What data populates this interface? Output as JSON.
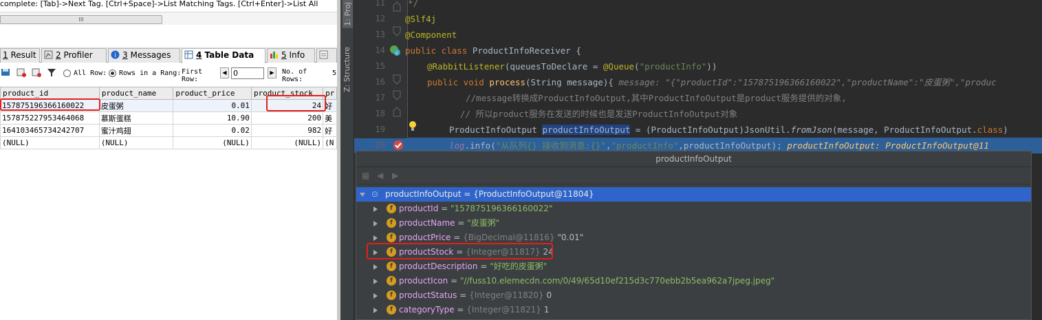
{
  "left": {
    "hint": "complete: [Tab]->Next Tag. [Ctrl+Space]->List Matching Tags. [Ctrl+Enter]->List All",
    "scroll_grip": "III",
    "tabs": [
      {
        "num": "1",
        "label": "Result"
      },
      {
        "num": "2",
        "label": "Profiler"
      },
      {
        "num": "3",
        "label": "Messages"
      },
      {
        "num": "4",
        "label": "Table Data"
      },
      {
        "num": "5",
        "label": "Info"
      }
    ],
    "toolbar": {
      "all_rows": "All Row:",
      "rows_in_range": "Rows in a Rang:",
      "first_row": "First\nRow:",
      "first_row_value": "0",
      "no_of_rows": "No. of\nRows:",
      "rows_value": "5"
    },
    "table": {
      "columns": [
        "product_id",
        "product_name",
        "product_price",
        "product_stock",
        "pr"
      ],
      "rows": [
        [
          "157875196366160022",
          "皮蛋粥",
          "0.01",
          "24",
          "好"
        ],
        [
          "157875227953464068",
          "慕斯蛋糕",
          "10.90",
          "200",
          "美"
        ],
        [
          "164103465734242707",
          "蜜汁鸡翅",
          "0.02",
          "982",
          "好"
        ],
        [
          "(NULL)",
          "(NULL)",
          "(NULL)",
          "(NULL)",
          "(N"
        ]
      ]
    }
  },
  "ide": {
    "side_tabs": [
      "1: Proj",
      "Z: Structure"
    ],
    "lines": [
      {
        "n": "11"
      },
      {
        "n": "12"
      },
      {
        "n": "13"
      },
      {
        "n": "14"
      },
      {
        "n": "15"
      },
      {
        "n": "16"
      },
      {
        "n": "17"
      },
      {
        "n": "18"
      },
      {
        "n": "19"
      },
      {
        "n": "20"
      }
    ],
    "code": {
      "l11": "*/",
      "l12": "@Slf4j",
      "l13": "@Component",
      "l14_kw": "public class ",
      "l14_name": "ProductInfoReceiver {",
      "l15_an": "@RabbitListener",
      "l15_a": "(queuesToDeclare = ",
      "l15_q": "@Queue",
      "l15_b": "(",
      "l15_s": "\"productInfo\"",
      "l15_c": "))",
      "l16_kw": "public void ",
      "l16_fn": "process",
      "l16_args": "(String message){  ",
      "l16_hint": "message: \"{\"productId\":\"157875196366160022\",\"productName\":\"皮蛋粥\",\"produc",
      "l17": "//message转换成ProductInfoOutput,其中ProductInfoOutput是product服务提供的对象,",
      "l18": "// 所以product服务在发送的时候也是发送ProductInfoOutput对象",
      "l19_a": "ProductInfoOutput ",
      "l19_sel": "productInfoOutput",
      "l19_b": " = (ProductInfoOutput)JsonUtil.",
      "l19_fn": "fromJson",
      "l19_c": "(message, ProductInfoOutput.",
      "l19_kw": "class",
      "l19_d": ")",
      "l20_log": "log",
      "l20_a": ".info(",
      "l20_s1": "\"从队列{} 接收到消息:{}\"",
      "l20_b": ",",
      "l20_s2": "\"productInfo\"",
      "l20_c": ",productInfoOutput);  ",
      "l20_hint": "productInfoOutput: ProductInfoOutput@11"
    },
    "popup": {
      "title": "productInfoOutput",
      "root": {
        "name": "productInfoOutput",
        "value": " = {ProductInfoOutput@11804}"
      },
      "fields": [
        {
          "name": "productId",
          "eq": " = ",
          "ref": "",
          "val": "\"157875196366160022\"",
          "kind": "str"
        },
        {
          "name": "productName",
          "eq": " = ",
          "ref": "",
          "val": "\"皮蛋粥\"",
          "kind": "str"
        },
        {
          "name": "productPrice",
          "eq": " = ",
          "ref": "{BigDecimal@11816} ",
          "val": "\"0.01\"",
          "kind": "num"
        },
        {
          "name": "productStock",
          "eq": " = ",
          "ref": "{Integer@11817} ",
          "val": "24",
          "kind": "num"
        },
        {
          "name": "productDescription",
          "eq": " = ",
          "ref": "",
          "val": "\"好吃的皮蛋粥\"",
          "kind": "str"
        },
        {
          "name": "productIcon",
          "eq": " = ",
          "ref": "",
          "val": "\"//fuss10.elemecdn.com/0/49/65d10ef215d3c770ebb2b5ea962a7jpeg.jpeg\"",
          "kind": "str"
        },
        {
          "name": "productStatus",
          "eq": " = ",
          "ref": "{Integer@11820} ",
          "val": "0",
          "kind": "num"
        },
        {
          "name": "categoryType",
          "eq": " = ",
          "ref": "{Integer@11821} ",
          "val": "1",
          "kind": "num"
        }
      ]
    }
  },
  "colors": {
    "highlight_box": "#e3201b",
    "ide_bg": "#2b2b2b",
    "debug_line": "#2d6099",
    "tree_selection": "#2f65ca"
  },
  "icons": [
    "result-icon",
    "profiler-icon",
    "messages-icon",
    "table-data-icon",
    "info-icon",
    "history-icon",
    "save-icon",
    "refresh-icon",
    "filter-icon",
    "spring-bean-icon",
    "bulb-icon",
    "breakpoint-icon",
    "field-icon",
    "expand-arrow-icon"
  ]
}
